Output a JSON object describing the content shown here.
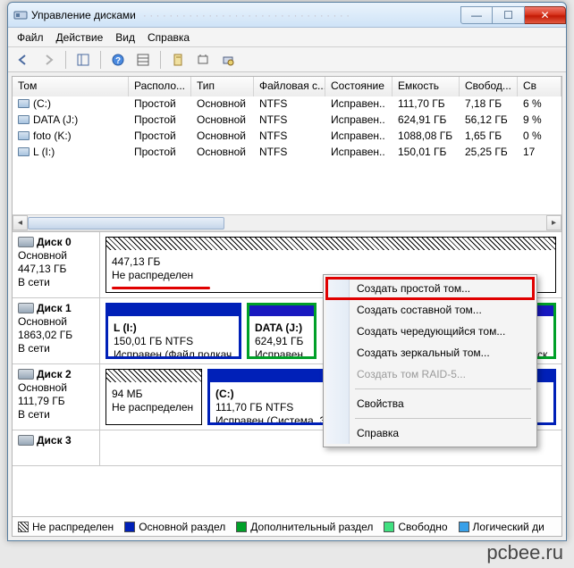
{
  "window": {
    "title": "Управление дисками"
  },
  "menu": {
    "file": "Файл",
    "action": "Действие",
    "view": "Вид",
    "help": "Справка"
  },
  "table": {
    "headers": {
      "vol": "Том",
      "layout": "Располо...",
      "type": "Тип",
      "fs": "Файловая с...",
      "state": "Состояние",
      "cap": "Емкость",
      "free": "Свобод...",
      "pct": "Св"
    },
    "rows": [
      {
        "vol": "(C:)",
        "layout": "Простой",
        "type": "Основной",
        "fs": "NTFS",
        "state": "Исправен..",
        "cap": "111,70 ГБ",
        "free": "7,18 ГБ",
        "pct": "6 %"
      },
      {
        "vol": "DATA (J:)",
        "layout": "Простой",
        "type": "Основной",
        "fs": "NTFS",
        "state": "Исправен..",
        "cap": "624,91 ГБ",
        "free": "56,12 ГБ",
        "pct": "9 %"
      },
      {
        "vol": "foto (K:)",
        "layout": "Простой",
        "type": "Основной",
        "fs": "NTFS",
        "state": "Исправен..",
        "cap": "1088,08 ГБ",
        "free": "1,65 ГБ",
        "pct": "0 %"
      },
      {
        "vol": "L (I:)",
        "layout": "Простой",
        "type": "Основной",
        "fs": "NTFS",
        "state": "Исправен..",
        "cap": "150,01 ГБ",
        "free": "25,25 ГБ",
        "pct": "17"
      }
    ]
  },
  "disks": {
    "d0": {
      "name": "Диск 0",
      "type": "Основной",
      "size": "447,13 ГБ",
      "status": "В сети",
      "p0": {
        "size": "447,13 ГБ",
        "state": "Не распределен"
      }
    },
    "d1": {
      "name": "Диск 1",
      "type": "Основной",
      "size": "1863,02 ГБ",
      "status": "В сети",
      "p0": {
        "title": "L  (I:)",
        "line1": "150,01 ГБ NTFS",
        "line2": "Исправен (Файл подкач"
      },
      "p1": {
        "title": "DATA  (J:)",
        "line1": "624,91 ГБ",
        "line2": "Исправен"
      },
      "p2": {
        "line2": "ск.."
      }
    },
    "d2": {
      "name": "Диск 2",
      "type": "Основной",
      "size": "111,79 ГБ",
      "status": "В сети",
      "p0": {
        "size": "94 МБ",
        "state": "Не распределен"
      },
      "p1": {
        "title": "(C:)",
        "line1": "111,70 ГБ NTFS",
        "line2": "Исправен (Система, Загрузка, Активен, Аварийнь"
      }
    },
    "d3": {
      "name": "Диск 3"
    }
  },
  "ctx": {
    "simple": "Создать простой том...",
    "spanned": "Создать составной том...",
    "striped": "Создать чередующийся том...",
    "mirror": "Создать зеркальный том...",
    "raid5": "Создать том RAID-5...",
    "props": "Свойства",
    "help": "Справка"
  },
  "legend": {
    "unalloc": "Не распределен",
    "primary": "Основной раздел",
    "extended": "Дополнительный раздел",
    "free": "Свободно",
    "logical": "Логический ди"
  },
  "site": "pcbee.ru"
}
